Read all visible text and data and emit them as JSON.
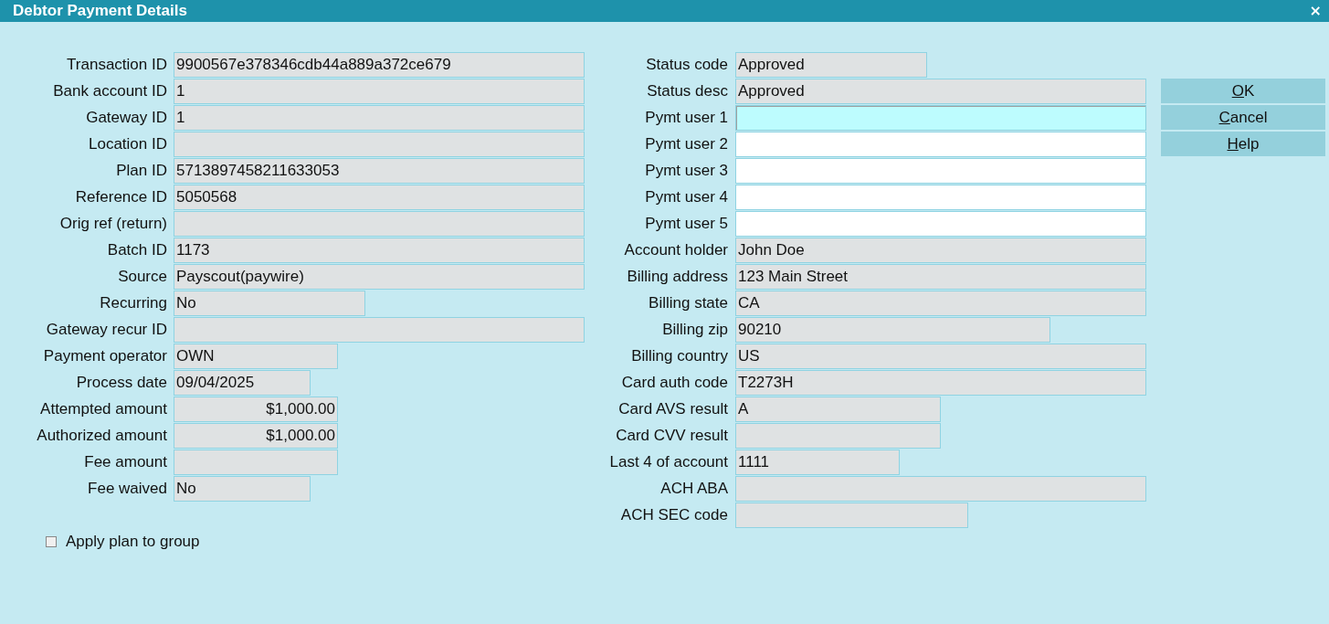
{
  "window": {
    "title": "Debtor Payment Details",
    "close": "×"
  },
  "left_fields": [
    {
      "label": "Transaction ID",
      "value": "9900567e378346cdb44a889a372ce679",
      "kind": "text",
      "editable": false,
      "focused": false
    },
    {
      "label": "Bank account ID",
      "value": "1",
      "kind": "text",
      "editable": false,
      "focused": false
    },
    {
      "label": "Gateway ID",
      "value": "1",
      "kind": "text",
      "editable": false,
      "focused": false
    },
    {
      "label": "Location ID",
      "kind": "text",
      "editable": false,
      "focused": false
    },
    {
      "label": "Plan ID",
      "value": "5713897458211633053",
      "kind": "text",
      "editable": false,
      "focused": false
    },
    {
      "label": "Reference ID",
      "value": "5050568",
      "kind": "text",
      "editable": false,
      "focused": false
    },
    {
      "label": "Orig ref (return)",
      "kind": "text",
      "editable": false,
      "focused": false
    },
    {
      "label": "Batch ID",
      "value": "1173",
      "kind": "text",
      "editable": false,
      "focused": false
    },
    {
      "label": "Source",
      "value": "Payscout(paywire)",
      "kind": "text",
      "editable": false,
      "focused": false
    },
    {
      "label": "Recurring",
      "value": "No",
      "kind": "text",
      "editable": false,
      "focused": false
    },
    {
      "label": "Gateway recur ID",
      "kind": "text",
      "editable": false,
      "focused": false
    },
    {
      "label": "Payment operator",
      "value": "OWN",
      "kind": "text",
      "editable": false,
      "focused": false
    },
    {
      "label": "Process date",
      "value": "09/04/2025",
      "kind": "text",
      "editable": false,
      "focused": false
    },
    {
      "label": "Attempted amount",
      "value": "$1,000.00",
      "kind": "amount",
      "editable": false,
      "focused": false
    },
    {
      "label": "Authorized amount",
      "value": "$1,000.00",
      "kind": "amount",
      "editable": false,
      "focused": false
    },
    {
      "label": "Fee amount",
      "kind": "amount",
      "editable": false,
      "focused": false
    },
    {
      "label": "Fee waived",
      "value": "No",
      "kind": "text",
      "editable": false,
      "focused": false
    }
  ],
  "right_fields": [
    {
      "label": "Status code",
      "value": "Approved",
      "kind": "text",
      "editable": false,
      "focused": false
    },
    {
      "label": "Status desc",
      "value": "Approved",
      "kind": "text",
      "editable": false,
      "focused": false
    },
    {
      "label": "Pymt user 1",
      "kind": "text",
      "editable": true,
      "focused": true
    },
    {
      "label": "Pymt user 2",
      "kind": "text",
      "editable": true,
      "focused": false
    },
    {
      "label": "Pymt user 3",
      "kind": "text",
      "editable": true,
      "focused": false
    },
    {
      "label": "Pymt user 4",
      "kind": "text",
      "editable": true,
      "focused": false
    },
    {
      "label": "Pymt user 5",
      "kind": "text",
      "editable": true,
      "focused": false
    },
    {
      "label": "Account holder",
      "value": "John Doe",
      "kind": "text",
      "editable": false,
      "focused": false
    },
    {
      "label": "Billing address",
      "value": "123 Main Street",
      "kind": "text",
      "editable": false,
      "focused": false
    },
    {
      "label": "Billing state",
      "value": "CA",
      "kind": "text",
      "editable": false,
      "focused": false
    },
    {
      "label": "Billing zip",
      "value": "90210",
      "kind": "text",
      "editable": false,
      "focused": false
    },
    {
      "label": "Billing country",
      "value": "US",
      "kind": "text",
      "editable": false,
      "focused": false
    },
    {
      "label": "Card auth code",
      "value": "T2273H",
      "kind": "text",
      "editable": false,
      "focused": false
    },
    {
      "label": "Card AVS result",
      "value": "A",
      "kind": "text",
      "editable": false,
      "focused": false
    },
    {
      "label": "Card CVV result",
      "kind": "text",
      "editable": false,
      "focused": false
    },
    {
      "label": "Last 4 of account",
      "value": "1111",
      "kind": "text",
      "editable": false,
      "focused": false
    },
    {
      "label": "ACH ABA",
      "kind": "text",
      "editable": false,
      "focused": false
    },
    {
      "label": "ACH SEC code",
      "kind": "text",
      "editable": false,
      "focused": false
    }
  ],
  "buttons": [
    "OK",
    "Cancel",
    "Help"
  ],
  "apply_plan_to_group": {
    "label": "Apply plan to group",
    "checked": false
  }
}
